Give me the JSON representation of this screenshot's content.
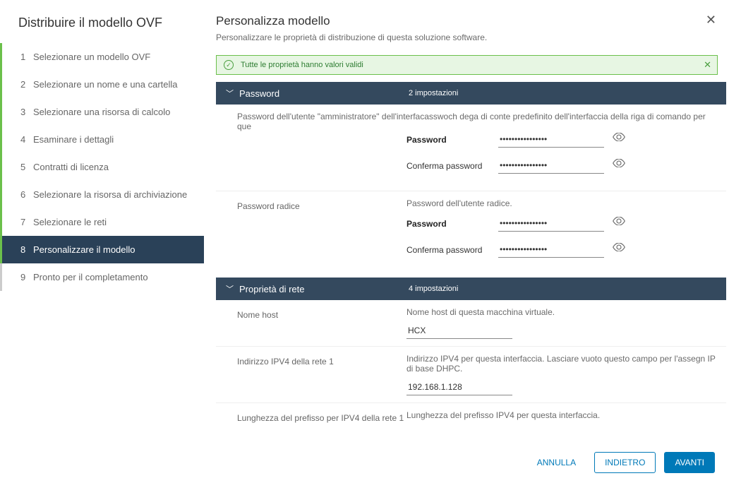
{
  "sidebar": {
    "title": "Distribuire il modello OVF",
    "steps": [
      {
        "num": "1",
        "label": "Selezionare un modello OVF",
        "state": "done"
      },
      {
        "num": "2",
        "label": "Selezionare un nome e una cartella",
        "state": "done"
      },
      {
        "num": "3",
        "label": "Selezionare una risorsa di calcolo",
        "state": "done"
      },
      {
        "num": "4",
        "label": "Esaminare i dettagli",
        "state": "done"
      },
      {
        "num": "5",
        "label": "Contratti di licenza",
        "state": "done"
      },
      {
        "num": "6",
        "label": "Selezionare la risorsa di archiviazione",
        "state": "done"
      },
      {
        "num": "7",
        "label": "Selezionare le reti",
        "state": "done"
      },
      {
        "num": "8",
        "label": "Personalizzare il modello",
        "state": "active"
      },
      {
        "num": "9",
        "label": "Pronto per il completamento",
        "state": "pending"
      }
    ]
  },
  "main": {
    "title": "Personalizza modello",
    "subtitle": "Personalizzare le proprietà di distribuzione di questa soluzione software."
  },
  "banner": {
    "text": "Tutte le proprietà hanno valori validi"
  },
  "sections": {
    "password": {
      "title": "Password",
      "count": "2 impostazioni",
      "admin_desc": "Password dell'utente \"amministratore\" dell'interfacasswoch dega di conte predefinito dell'interfaccia della riga di comando per que",
      "password_label": "Password",
      "confirm_label": "Conferma password",
      "admin_pw_value": "••••••••••••••••",
      "admin_confirm_value": "••••••••••••••••",
      "root_label": "Password radice",
      "root_desc": "Password dell'utente radice.",
      "root_pw_value": "••••••••••••••••",
      "root_confirm_value": "••••••••••••••••"
    },
    "network": {
      "title": "Proprietà di rete",
      "count": "4 impostazioni",
      "hostname_label": "Nome host",
      "hostname_desc": "Nome host di questa macchina virtuale.",
      "hostname_value": "HCX",
      "ipv4_label": "Indirizzo IPV4 della rete 1",
      "ipv4_desc": "Indirizzo IPV4 per questa interfaccia. Lasciare vuoto questo campo per l'assegn IP di base DHPC.",
      "ipv4_value": "192.168.1.128",
      "prefix_label": "Lunghezza del prefisso per IPV4 della rete 1",
      "prefix_desc": "Lunghezza del prefisso IPV4 per questa interfaccia."
    }
  },
  "footer": {
    "cancel": "ANNULLA",
    "back": "INDIETRO",
    "next": "AVANTI"
  }
}
